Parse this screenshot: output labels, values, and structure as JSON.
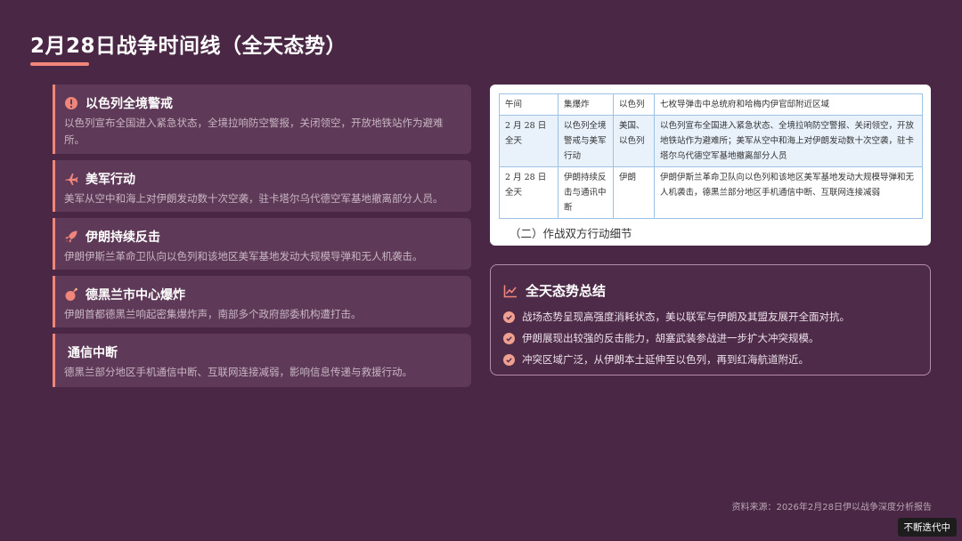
{
  "page": {
    "title": "2月28日战争时间线（全天态势）",
    "accent_color": "#f0857a"
  },
  "timeline": [
    {
      "icon": "exclamation-icon",
      "title": "以色列全境警戒",
      "text": "以色列宣布全国进入紧急状态，全境拉响防空警报，关闭领空，开放地铁站作为避难所。"
    },
    {
      "icon": "plane-icon",
      "title": "美军行动",
      "text": "美军从空中和海上对伊朗发动数十次空袭，驻卡塔尔乌代德空军基地撤离部分人员。"
    },
    {
      "icon": "rocket-icon",
      "title": "伊朗持续反击",
      "text": "伊朗伊斯兰革命卫队向以色列和该地区美军基地发动大规模导弹和无人机袭击。"
    },
    {
      "icon": "bomb-icon",
      "title": "德黑兰市中心爆炸",
      "text": "伊朗首都德黑兰响起密集爆炸声，南部多个政府部委机构遭打击。"
    },
    {
      "icon": "",
      "title": "通信中断",
      "text": "德黑兰部分地区手机通信中断、互联网连接减弱，影响信息传递与救援行动。"
    }
  ],
  "doc_table": {
    "rows": [
      [
        "午间",
        "集爆炸",
        "以色列",
        "七枚导弹击中总统府和哈梅内伊官邸附近区域"
      ],
      [
        "2 月 28 日全天",
        "以色列全境警戒与美军行动",
        "美国、以色列",
        "以色列宣布全国进入紧急状态、全境拉响防空警报、关闭领空，开放地铁站作为避难所；美军从空中和海上对伊朗发动数十次空袭，驻卡塔尔乌代德空军基地撤离部分人员"
      ],
      [
        "2 月 28 日全天",
        "伊朗持续反击与通讯中断",
        "伊朗",
        "伊朗伊斯兰革命卫队向以色列和该地区美军基地发动大规模导弹和无人机袭击，德黑兰部分地区手机通信中断、互联网连接减弱"
      ]
    ],
    "caption": "（二）作战双方行动细节"
  },
  "summary": {
    "icon": "chart-line-icon",
    "title": "全天态势总结",
    "items": [
      "战场态势呈现高强度消耗状态，美以联军与伊朗及其盟友展开全面对抗。",
      "伊朗展现出较强的反击能力，胡塞武装参战进一步扩大冲突规模。",
      "冲突区域广泛，从伊朗本土延伸至以色列，再到红海航道附近。"
    ]
  },
  "footer": {
    "source": "资料来源：2026年2月28日伊以战争深度分析报告",
    "badge": "不断迭代中"
  }
}
